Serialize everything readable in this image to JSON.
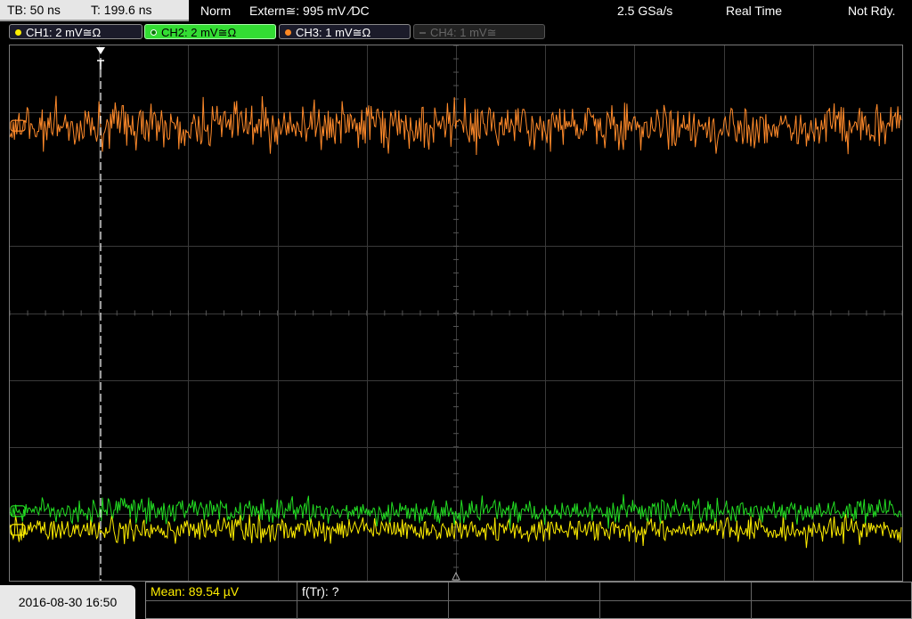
{
  "topbar": {
    "timebase": "TB: 50 ns",
    "trigger_time": "T: 199.6 ns",
    "mode": "Norm",
    "trigger_source": "Extern≅: 995 mV ∕DC",
    "sample_rate": "2.5 GSa/s",
    "acq_mode": "Real Time",
    "state": "Not Rdy."
  },
  "channels": [
    {
      "label": "CH1: 2 mV≅Ω",
      "color": "#ffee00"
    },
    {
      "label": "CH2: 2 mV≅Ω",
      "color": "#33dd33"
    },
    {
      "label": "CH3: 1 mV≅Ω",
      "color": "#ff8822"
    },
    {
      "label": "CH4: 1 mV≅",
      "color": "#666666"
    }
  ],
  "bottom": {
    "datetime": "2016-08-30 16:50",
    "mean": "Mean: 89.54 µV",
    "ftr": "f(Tr): ?"
  },
  "colors": {
    "ch1": "#ffee00",
    "ch2": "#22dd22",
    "ch3": "#ff8a2a",
    "grid": "#3a3a3a",
    "mean_text": "#ffee00"
  },
  "trace_levels": {
    "ch3_frac": 0.15,
    "ch2_frac": 0.87,
    "ch1_frac": 0.905
  }
}
